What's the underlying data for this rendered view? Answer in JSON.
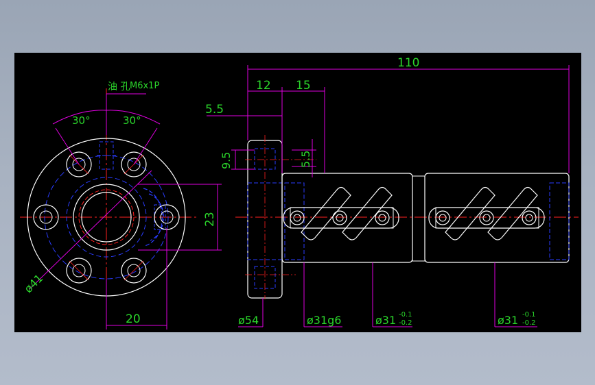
{
  "drawing": {
    "colors": {
      "background": "#000000",
      "outline": "#ffffff",
      "dimension": "#e100e1",
      "dimension_text": "#2bd62b",
      "hidden": "#2a3cff",
      "centerline": "#ff2020",
      "note_text": "#2bd62b"
    },
    "oil_hole_label": "油 孔",
    "oil_hole_spec": "M6x1P",
    "angle_left": "30°",
    "angle_right": "30°",
    "dim_flange_dia": "ø41",
    "dim_bolt_offset": "20",
    "dim_height_23": "23",
    "dim_total_length": "110",
    "dim_flange_12": "12",
    "dim_15": "15",
    "dim_5_5_top": "5.5",
    "dim_9_5": "9.5",
    "dim_5_5_side": "5.5",
    "dim_54": "ø54",
    "dim_31g6": "ø31g6",
    "dim_31_a": "ø31",
    "dim_31_b": "ø31",
    "tol_upper": "-0.1",
    "tol_lower": "-0.2"
  }
}
